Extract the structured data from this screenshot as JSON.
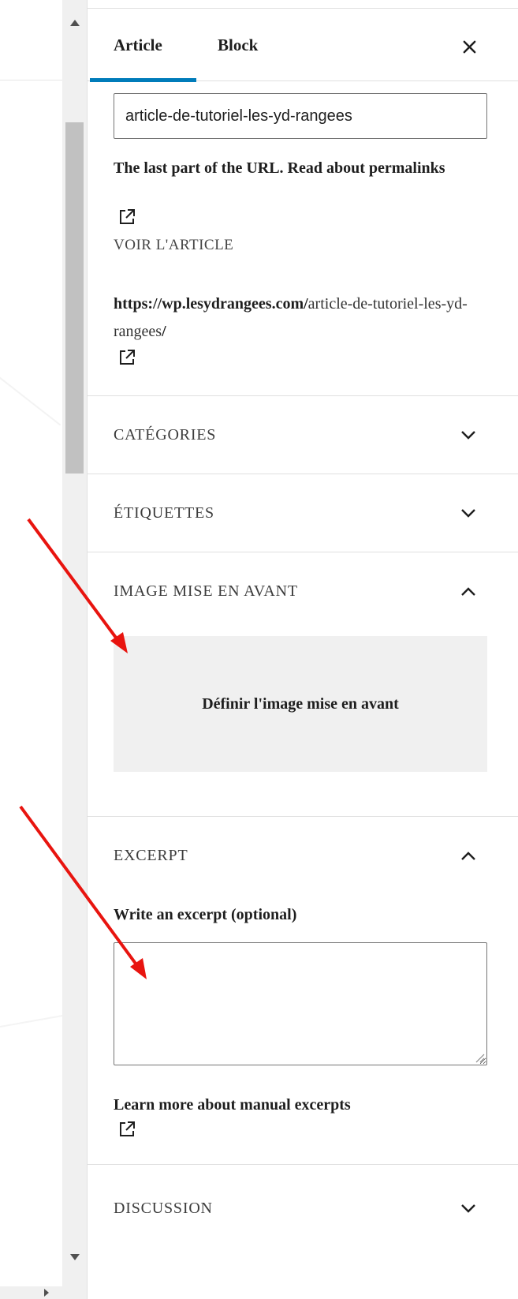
{
  "tabs": {
    "article_label": "Article",
    "block_label": "Block"
  },
  "permalink": {
    "slug_value": "article-de-tutoriel-les-yd-rangees",
    "help_text": "The last part of the URL. Read about permalinks",
    "view_label": "VOIR L'ARTICLE",
    "url_base": "https://wp.lesydrangees.com/",
    "url_slug": "article-de-tutoriel-les-yd-rangees",
    "url_end": "/"
  },
  "panels": {
    "categories_title": "CATÉGORIES",
    "tags_title": "ÉTIQUETTES",
    "featured_title": "IMAGE MISE EN AVANT",
    "excerpt_title": "EXCERPT",
    "discussion_title": "DISCUSSION"
  },
  "featured_image": {
    "button_label": "Définir l'image mise en avant"
  },
  "excerpt": {
    "label": "Write an excerpt (optional)",
    "value": "",
    "learn_more": "Learn more about manual excerpts"
  },
  "colors": {
    "accent": "#007cba",
    "annotation_arrow": "#e8140f"
  },
  "icons": {
    "close": "close-icon",
    "external": "external-link-icon",
    "expand": "chevron-down-icon",
    "collapse": "chevron-up-icon"
  }
}
